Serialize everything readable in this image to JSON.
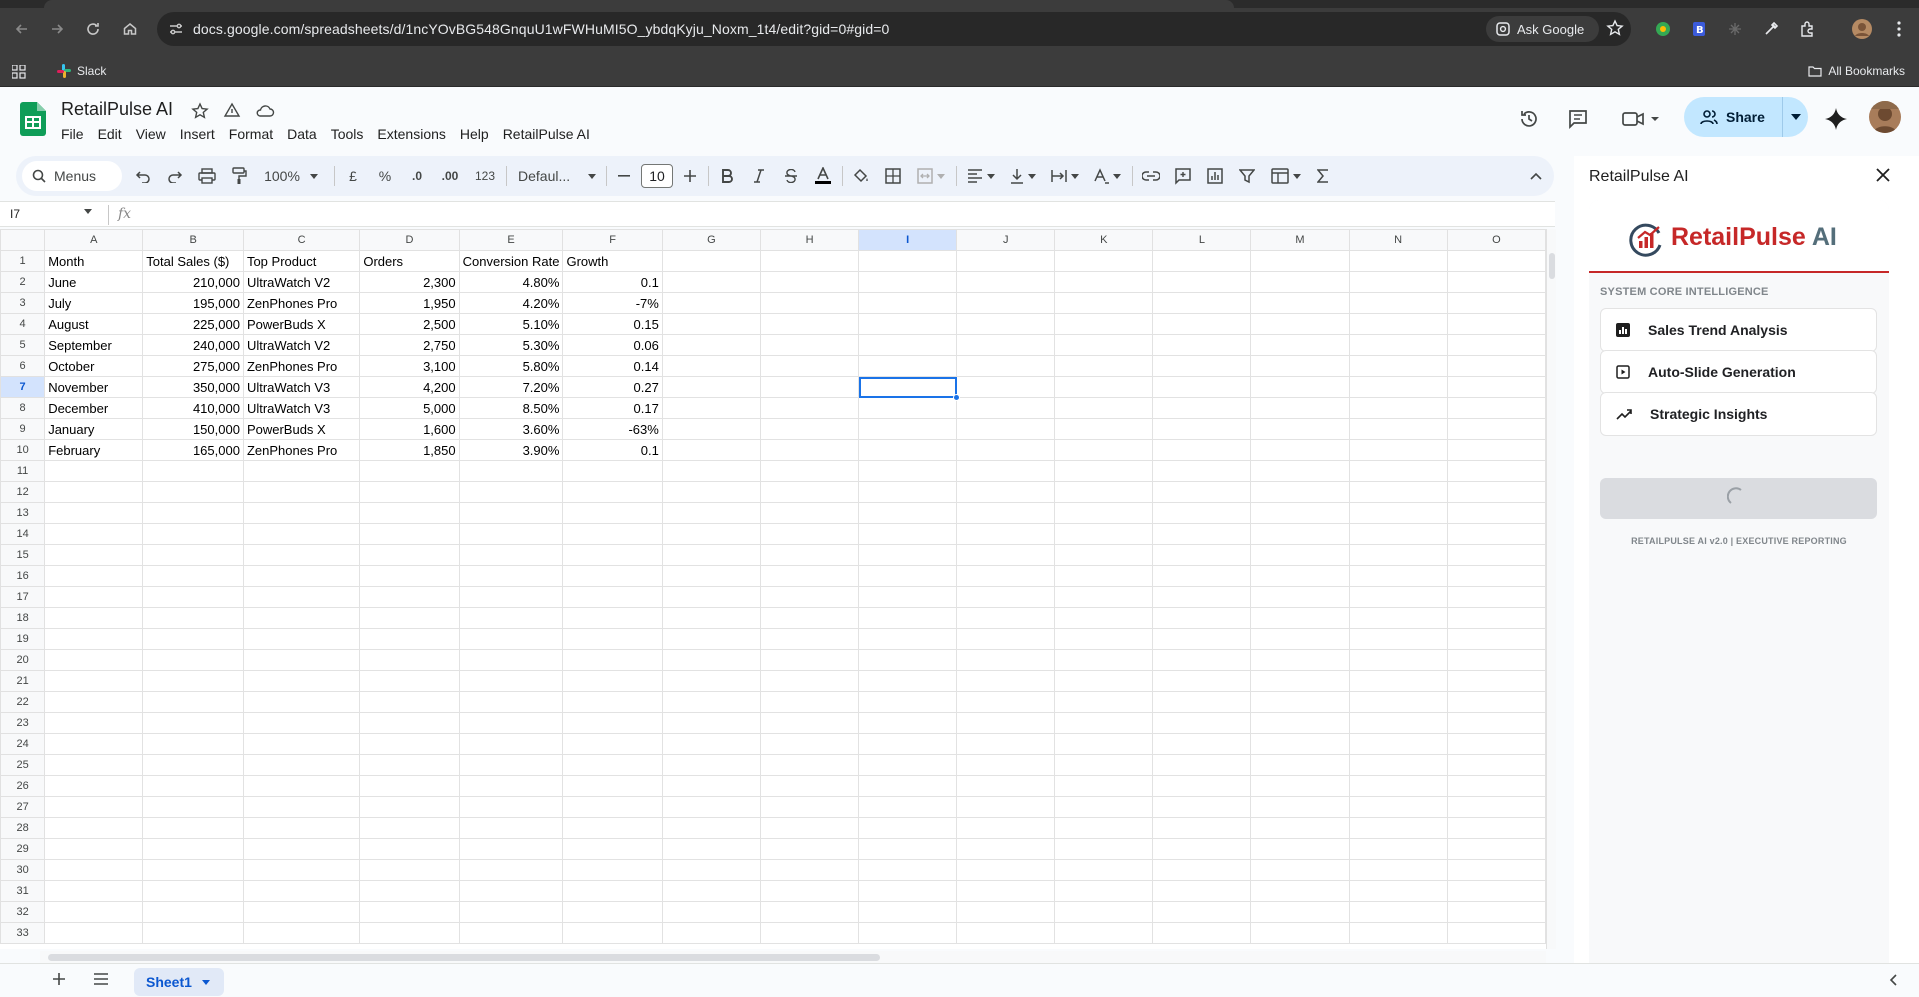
{
  "browser": {
    "url": "docs.google.com/spreadsheets/d/1ncYOvBG548GnquU1wFWHuMI5O_ybdqKyju_Noxm_1t4/edit?gid=0#gid=0",
    "ask_google": "Ask Google",
    "bookmarks": {
      "slack": "Slack",
      "all": "All Bookmarks"
    }
  },
  "sheets": {
    "doc_title": "RetailPulse AI",
    "menus": [
      "File",
      "Edit",
      "View",
      "Insert",
      "Format",
      "Data",
      "Tools",
      "Extensions",
      "Help",
      "RetailPulse AI"
    ],
    "share_label": "Share",
    "toolbar": {
      "search": "Menus",
      "zoom": "100%",
      "currency": "£",
      "percent": "%",
      "dec_decrease": ".0",
      "dec_increase": ".00",
      "number_format": "123",
      "font": "Defaul...",
      "font_size": "10"
    },
    "name_box": "I7",
    "fx": "fx",
    "columns": [
      "A",
      "B",
      "C",
      "D",
      "E",
      "F",
      "G",
      "H",
      "I",
      "J",
      "K",
      "L",
      "M",
      "N",
      "O"
    ],
    "selected_cell": {
      "col": "I",
      "row": 7
    },
    "rows": [
      [
        "Month",
        "Total Sales ($)",
        "Top Product",
        "Orders",
        "Conversion Rate",
        "Growth"
      ],
      [
        "June",
        "210,000",
        "UltraWatch V2",
        "2,300",
        "4.80%",
        "0.1"
      ],
      [
        "July",
        "195,000",
        "ZenPhones Pro",
        "1,950",
        "4.20%",
        "-7%"
      ],
      [
        "August",
        "225,000",
        "PowerBuds X",
        "2,500",
        "5.10%",
        "0.15"
      ],
      [
        "September",
        "240,000",
        "UltraWatch V2",
        "2,750",
        "5.30%",
        "0.06"
      ],
      [
        "October",
        "275,000",
        "ZenPhones Pro",
        "3,100",
        "5.80%",
        "0.14"
      ],
      [
        "November",
        "350,000",
        "UltraWatch V3",
        "4,200",
        "7.20%",
        "0.27"
      ],
      [
        "December",
        "410,000",
        "UltraWatch V3",
        "5,000",
        "8.50%",
        "0.17"
      ],
      [
        "January",
        "150,000",
        "PowerBuds X",
        "1,600",
        "3.60%",
        "-63%"
      ],
      [
        "February",
        "165,000",
        "ZenPhones Pro",
        "1,850",
        "3.90%",
        "0.1"
      ]
    ],
    "total_rows": 33,
    "sheet_tab": "Sheet1"
  },
  "sidebar": {
    "title": "RetailPulse AI",
    "brand": {
      "name": "RetailPulse",
      "suffix": "AI"
    },
    "section_label": "SYSTEM CORE INTELLIGENCE",
    "features": [
      {
        "label": "Sales Trend Analysis",
        "icon": "bar-chart-icon"
      },
      {
        "label": "Auto-Slide Generation",
        "icon": "slide-play-icon"
      },
      {
        "label": "Strategic Insights",
        "icon": "trending-up-icon"
      }
    ],
    "footer": "RETAILPULSE AI v2.0 | EXECUTIVE REPORTING",
    "colors": {
      "brand_red": "#c62828",
      "brand_gray": "#546e7a"
    }
  }
}
